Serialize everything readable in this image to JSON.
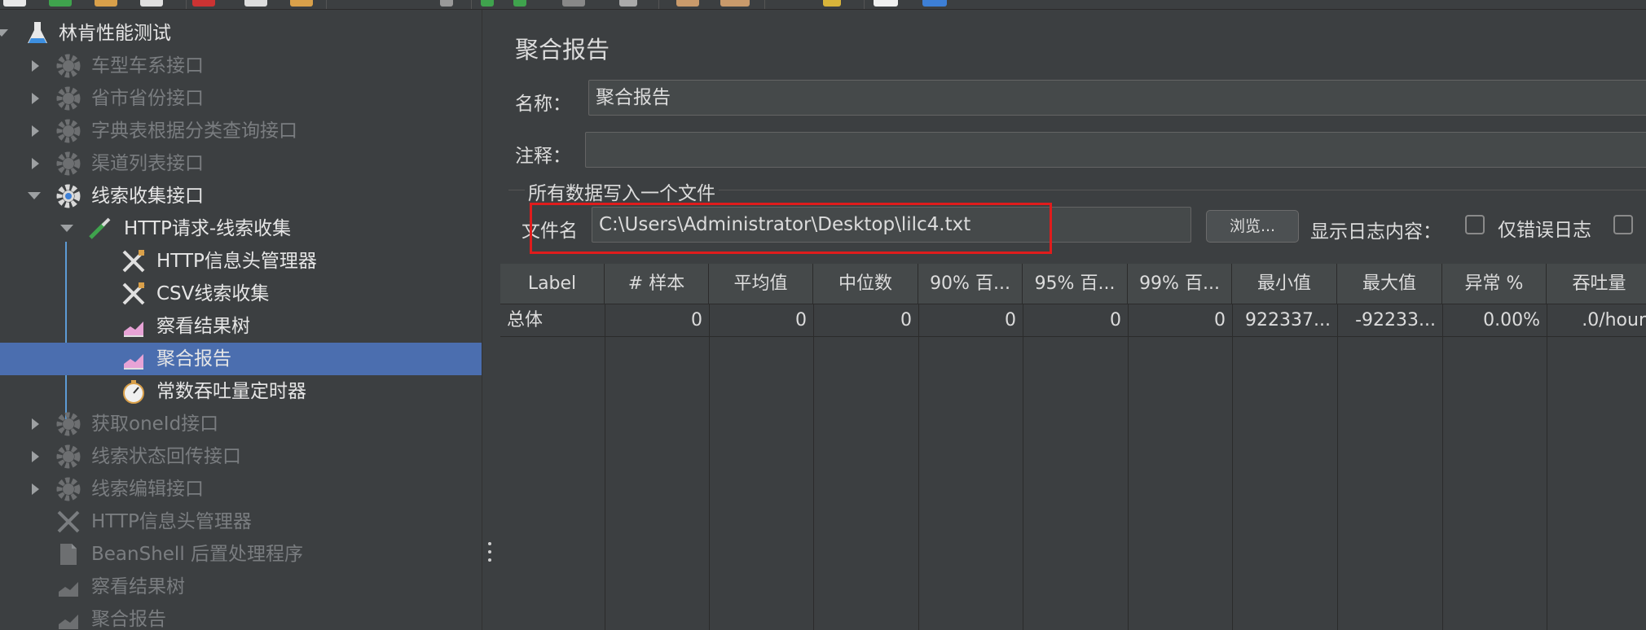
{
  "tree": {
    "root": {
      "label": "林肯性能测试"
    },
    "items": [
      {
        "label": "车型车系接口"
      },
      {
        "label": "省市省份接口"
      },
      {
        "label": "字典表根据分类查询接口"
      },
      {
        "label": "渠道列表接口"
      },
      {
        "label": "线索收集接口"
      },
      {
        "label": "HTTP请求-线索收集"
      },
      {
        "label": "HTTP信息头管理器"
      },
      {
        "label": "CSV线索收集"
      },
      {
        "label": "察看结果树"
      },
      {
        "label": "聚合报告"
      },
      {
        "label": "常数吞吐量定时器"
      },
      {
        "label": "获取oneId接口"
      },
      {
        "label": "线索状态回传接口"
      },
      {
        "label": "线索编辑接口"
      },
      {
        "label": "HTTP信息头管理器"
      },
      {
        "label": "BeanShell 后置处理程序"
      },
      {
        "label": "察看结果树"
      },
      {
        "label": "聚合报告"
      }
    ]
  },
  "panel": {
    "title": "聚合报告",
    "name_label": "名称：",
    "name_value": "聚合报告",
    "comment_label": "注释：",
    "comment_value": "",
    "fieldset_title": "所有数据写入一个文件",
    "filename_label": "文件名",
    "filename_value": "C:\\Users\\Administrator\\Desktop\\lilc4.txt",
    "browse_button": "浏览...",
    "log_content_label": "显示日志内容：",
    "errors_only_label": "仅错误日志"
  },
  "table": {
    "headers": [
      "Label",
      "# 样本",
      "平均值",
      "中位数",
      "90% 百...",
      "95% 百...",
      "99% 百...",
      "最小值",
      "最大值",
      "异常 %",
      "吞吐量"
    ],
    "rows": [
      [
        "总体",
        "0",
        "0",
        "0",
        "0",
        "0",
        "0",
        "922337...",
        "-92233...",
        "0.00%",
        ".0/hour"
      ]
    ]
  },
  "colors": {
    "background": "#3c3f41",
    "selection": "#4b6eaf",
    "highlight_box": "#e01c1c"
  }
}
